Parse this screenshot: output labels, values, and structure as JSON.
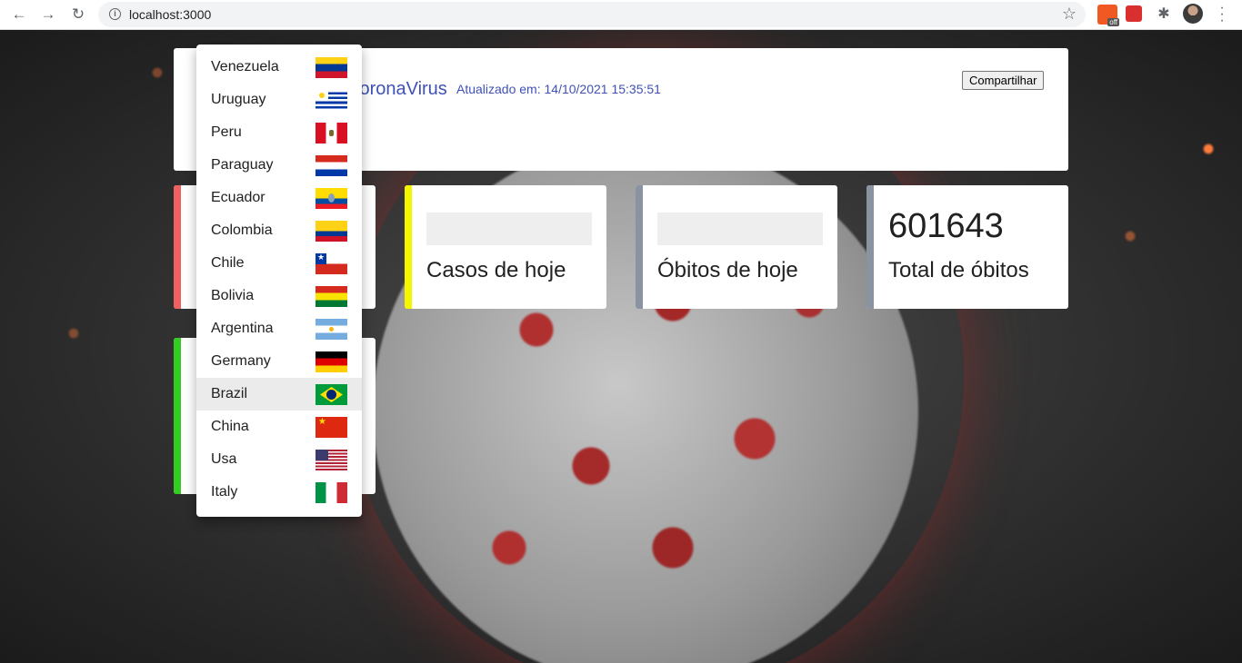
{
  "browser": {
    "url": "localhost:3000",
    "ext_badge": "off"
  },
  "header": {
    "brand": "CoronaVirus",
    "updated": "Atualizado em: 14/10/2021 15:35:51",
    "share_label": "Compartilhar"
  },
  "stats": [
    {
      "value": "",
      "label": "",
      "color": "#f06060"
    },
    {
      "value": "",
      "label": "Casos de hoje",
      "color": "#f5f500"
    },
    {
      "value": "",
      "label": "Óbitos de hoje",
      "color": "#8a93a2"
    },
    {
      "value": "601643",
      "label": "Total de óbitos",
      "color": "#8a93a2"
    }
  ],
  "lower_card": {
    "color": "#33cc22"
  },
  "country_dropdown": {
    "selected": "Brazil",
    "options": [
      {
        "name": "Venezuela",
        "flag": "venezuela-flag-icon"
      },
      {
        "name": "Uruguay",
        "flag": "uruguay-flag-icon"
      },
      {
        "name": "Peru",
        "flag": "peru-flag-icon"
      },
      {
        "name": "Paraguay",
        "flag": "paraguay-flag-icon"
      },
      {
        "name": "Ecuador",
        "flag": "ecuador-flag-icon"
      },
      {
        "name": "Colombia",
        "flag": "colombia-flag-icon"
      },
      {
        "name": "Chile",
        "flag": "chile-flag-icon"
      },
      {
        "name": "Bolivia",
        "flag": "bolivia-flag-icon"
      },
      {
        "name": "Argentina",
        "flag": "argentina-flag-icon"
      },
      {
        "name": "Germany",
        "flag": "germany-flag-icon"
      },
      {
        "name": "Brazil",
        "flag": "brazil-flag-icon"
      },
      {
        "name": "China",
        "flag": "china-flag-icon"
      },
      {
        "name": "Usa",
        "flag": "usa-flag-icon"
      },
      {
        "name": "Italy",
        "flag": "italy-flag-icon"
      }
    ]
  }
}
